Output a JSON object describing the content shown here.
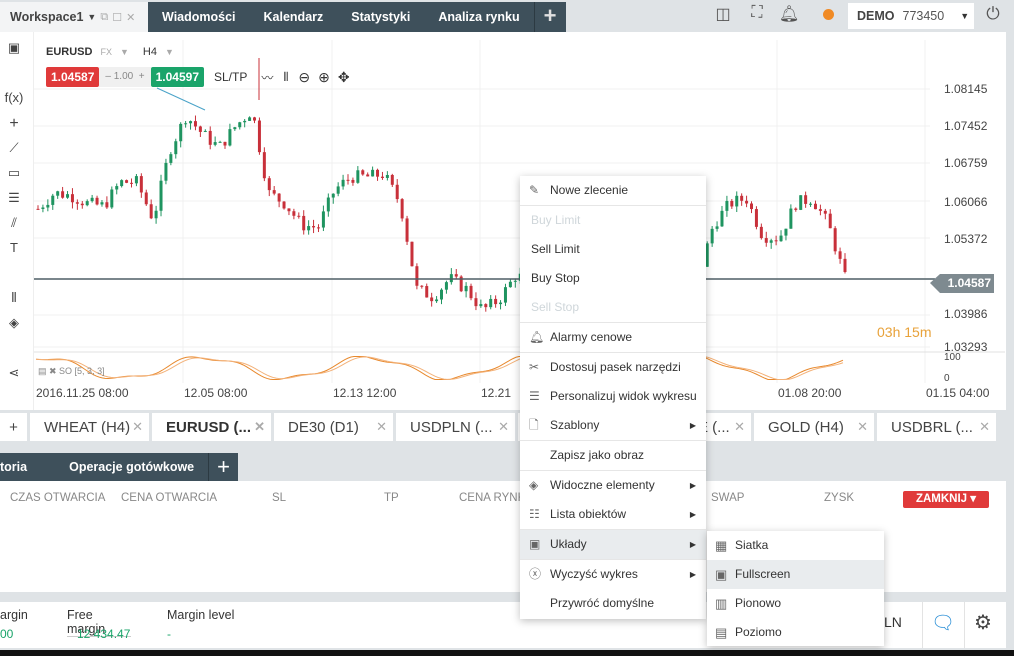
{
  "topbar": {
    "workspace": "Workspace1",
    "tabs": [
      "Wiadomości",
      "Kalendarz",
      "Statystyki",
      "Analiza rynku"
    ],
    "add": "+",
    "account_type": "DEMO",
    "account_number": "773450",
    "status_color": "#f08a24"
  },
  "chart": {
    "symbol": "EURUSD",
    "market": "FX",
    "timeframe": "H4",
    "sell_price": "1.04587",
    "quantity": "1.00",
    "buy_price": "1.04597",
    "sltp": "SL/TP",
    "price_ticks": [
      "1.08145",
      "1.07452",
      "1.06759",
      "1.06066",
      "1.05372",
      "1.04587",
      "1.03986",
      "1.03293"
    ],
    "current_price": "1.04587",
    "countdown": "03h 15m",
    "indicator": "SO [5, 3, 3]",
    "osc_ticks": [
      "100",
      "0"
    ],
    "time_ticks": [
      "2016.11.25 08:00",
      "12.05 08:00",
      "12.13 12:00",
      "12.21",
      "01.08 20:00",
      "01.15 04:00"
    ],
    "up_color": "#1f9460",
    "down_color": "#c8303a",
    "waypoints": [
      [
        1.059,
        1.062
      ],
      [
        1.0615,
        1.06
      ],
      [
        1.0595,
        1.064
      ],
      [
        1.064,
        1.057
      ],
      [
        1.07,
        1.0765
      ],
      [
        1.073,
        1.0705
      ],
      [
        1.0745,
        1.0775
      ],
      [
        1.062,
        1.06
      ],
      [
        1.056,
        1.0555
      ],
      [
        1.0625,
        1.065
      ],
      [
        1.065,
        1.0655
      ],
      [
        1.06,
        1.044
      ],
      [
        1.0425,
        1.046
      ],
      [
        1.044,
        1.04
      ],
      [
        1.042,
        1.0465
      ],
      [
        1.0455,
        1.046
      ],
      [
        1.045,
        1.045
      ],
      [
        1.045,
        1.044
      ],
      [
        1.044,
        1.044
      ],
      [
        1.044,
        1.041
      ],
      [
        1.045,
        1.056
      ],
      [
        1.06,
        1.061
      ],
      [
        1.054,
        1.0535
      ],
      [
        1.06,
        1.061
      ],
      [
        1.056,
        1.046
      ]
    ]
  },
  "chart_tabs": [
    {
      "label": "WHEAT (H4)"
    },
    {
      "label": "EURUSD (..."
    },
    {
      "label": "DE30 (D1)"
    },
    {
      "label": "USDPLN (..."
    },
    {
      "label": "E (..."
    },
    {
      "label": "GOLD (H4)"
    },
    {
      "label": "USDBRL (..."
    }
  ],
  "bottom": {
    "tabs": [
      "toria",
      "Operacje gotówkowe"
    ],
    "columns": [
      "CZAS OTWARCIA",
      "CENA OTWARCIA",
      "SL",
      "TP",
      "CENA RYNK",
      "SWAP",
      "ZYSK"
    ],
    "close_all": "ZAMKNIJ",
    "margin_label": "argin",
    "margin_value": "00",
    "free_margin_label": "Free margin",
    "free_margin_value": "12 434.47",
    "margin_level_label": "Margin level",
    "margin_level_value": "-",
    "currency_partial": "LN"
  },
  "context_menu": {
    "items": [
      "Nowe zlecenie",
      "Buy Limit",
      "Sell Limit",
      "Buy Stop",
      "Sell Stop",
      "Alarmy cenowe",
      "Dostosuj pasek narzędzi",
      "Personalizuj widok wykresu",
      "Szablony",
      "Zapisz jako obraz",
      "Widoczne elementy",
      "Lista obiektów",
      "Układy",
      "Wyczyść wykres",
      "Przywróć domyślne"
    ],
    "submenu": [
      "Siatka",
      "Fullscreen",
      "Pionowo",
      "Poziomo"
    ]
  }
}
